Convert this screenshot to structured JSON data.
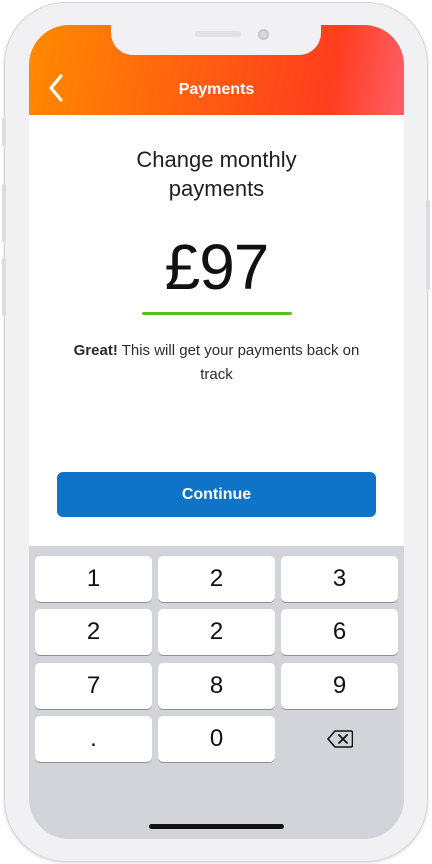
{
  "header": {
    "title": "Payments",
    "back_icon": "chevron-left-icon",
    "gradient_colors": [
      "#ff8a00",
      "#ff3d1f",
      "#ff5f6a"
    ]
  },
  "main": {
    "title_line1": "Change monthly",
    "title_line2": "payments",
    "amount": "£97",
    "message_bold": "Great!",
    "message_rest": " This will get your payments back on track",
    "accent_color": "#5fbf1a"
  },
  "continue_button": {
    "label": "Continue",
    "color": "#0f73c8"
  },
  "keypad": {
    "keys": [
      "1",
      "2",
      "3",
      "2",
      "2",
      "6",
      "7",
      "8",
      "9",
      ".",
      "0"
    ],
    "delete_icon": "backspace-icon"
  }
}
